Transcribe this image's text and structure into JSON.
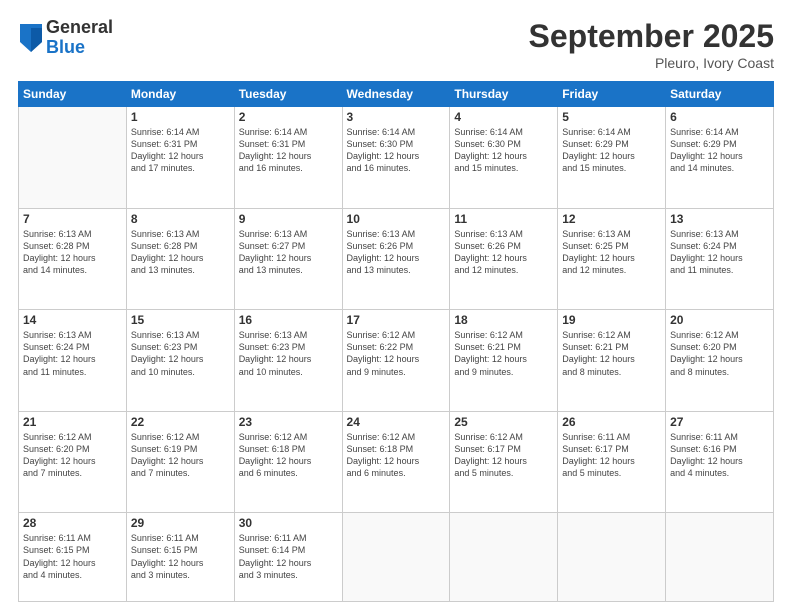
{
  "logo": {
    "general": "General",
    "blue": "Blue"
  },
  "title": "September 2025",
  "subtitle": "Pleuro, Ivory Coast",
  "days": [
    "Sunday",
    "Monday",
    "Tuesday",
    "Wednesday",
    "Thursday",
    "Friday",
    "Saturday"
  ],
  "weeks": [
    [
      {
        "num": "",
        "info": ""
      },
      {
        "num": "1",
        "info": "Sunrise: 6:14 AM\nSunset: 6:31 PM\nDaylight: 12 hours\nand 17 minutes."
      },
      {
        "num": "2",
        "info": "Sunrise: 6:14 AM\nSunset: 6:31 PM\nDaylight: 12 hours\nand 16 minutes."
      },
      {
        "num": "3",
        "info": "Sunrise: 6:14 AM\nSunset: 6:30 PM\nDaylight: 12 hours\nand 16 minutes."
      },
      {
        "num": "4",
        "info": "Sunrise: 6:14 AM\nSunset: 6:30 PM\nDaylight: 12 hours\nand 15 minutes."
      },
      {
        "num": "5",
        "info": "Sunrise: 6:14 AM\nSunset: 6:29 PM\nDaylight: 12 hours\nand 15 minutes."
      },
      {
        "num": "6",
        "info": "Sunrise: 6:14 AM\nSunset: 6:29 PM\nDaylight: 12 hours\nand 14 minutes."
      }
    ],
    [
      {
        "num": "7",
        "info": "Sunrise: 6:13 AM\nSunset: 6:28 PM\nDaylight: 12 hours\nand 14 minutes."
      },
      {
        "num": "8",
        "info": "Sunrise: 6:13 AM\nSunset: 6:28 PM\nDaylight: 12 hours\nand 13 minutes."
      },
      {
        "num": "9",
        "info": "Sunrise: 6:13 AM\nSunset: 6:27 PM\nDaylight: 12 hours\nand 13 minutes."
      },
      {
        "num": "10",
        "info": "Sunrise: 6:13 AM\nSunset: 6:26 PM\nDaylight: 12 hours\nand 13 minutes."
      },
      {
        "num": "11",
        "info": "Sunrise: 6:13 AM\nSunset: 6:26 PM\nDaylight: 12 hours\nand 12 minutes."
      },
      {
        "num": "12",
        "info": "Sunrise: 6:13 AM\nSunset: 6:25 PM\nDaylight: 12 hours\nand 12 minutes."
      },
      {
        "num": "13",
        "info": "Sunrise: 6:13 AM\nSunset: 6:24 PM\nDaylight: 12 hours\nand 11 minutes."
      }
    ],
    [
      {
        "num": "14",
        "info": "Sunrise: 6:13 AM\nSunset: 6:24 PM\nDaylight: 12 hours\nand 11 minutes."
      },
      {
        "num": "15",
        "info": "Sunrise: 6:13 AM\nSunset: 6:23 PM\nDaylight: 12 hours\nand 10 minutes."
      },
      {
        "num": "16",
        "info": "Sunrise: 6:13 AM\nSunset: 6:23 PM\nDaylight: 12 hours\nand 10 minutes."
      },
      {
        "num": "17",
        "info": "Sunrise: 6:12 AM\nSunset: 6:22 PM\nDaylight: 12 hours\nand 9 minutes."
      },
      {
        "num": "18",
        "info": "Sunrise: 6:12 AM\nSunset: 6:21 PM\nDaylight: 12 hours\nand 9 minutes."
      },
      {
        "num": "19",
        "info": "Sunrise: 6:12 AM\nSunset: 6:21 PM\nDaylight: 12 hours\nand 8 minutes."
      },
      {
        "num": "20",
        "info": "Sunrise: 6:12 AM\nSunset: 6:20 PM\nDaylight: 12 hours\nand 8 minutes."
      }
    ],
    [
      {
        "num": "21",
        "info": "Sunrise: 6:12 AM\nSunset: 6:20 PM\nDaylight: 12 hours\nand 7 minutes."
      },
      {
        "num": "22",
        "info": "Sunrise: 6:12 AM\nSunset: 6:19 PM\nDaylight: 12 hours\nand 7 minutes."
      },
      {
        "num": "23",
        "info": "Sunrise: 6:12 AM\nSunset: 6:18 PM\nDaylight: 12 hours\nand 6 minutes."
      },
      {
        "num": "24",
        "info": "Sunrise: 6:12 AM\nSunset: 6:18 PM\nDaylight: 12 hours\nand 6 minutes."
      },
      {
        "num": "25",
        "info": "Sunrise: 6:12 AM\nSunset: 6:17 PM\nDaylight: 12 hours\nand 5 minutes."
      },
      {
        "num": "26",
        "info": "Sunrise: 6:11 AM\nSunset: 6:17 PM\nDaylight: 12 hours\nand 5 minutes."
      },
      {
        "num": "27",
        "info": "Sunrise: 6:11 AM\nSunset: 6:16 PM\nDaylight: 12 hours\nand 4 minutes."
      }
    ],
    [
      {
        "num": "28",
        "info": "Sunrise: 6:11 AM\nSunset: 6:15 PM\nDaylight: 12 hours\nand 4 minutes."
      },
      {
        "num": "29",
        "info": "Sunrise: 6:11 AM\nSunset: 6:15 PM\nDaylight: 12 hours\nand 3 minutes."
      },
      {
        "num": "30",
        "info": "Sunrise: 6:11 AM\nSunset: 6:14 PM\nDaylight: 12 hours\nand 3 minutes."
      },
      {
        "num": "",
        "info": ""
      },
      {
        "num": "",
        "info": ""
      },
      {
        "num": "",
        "info": ""
      },
      {
        "num": "",
        "info": ""
      }
    ]
  ]
}
